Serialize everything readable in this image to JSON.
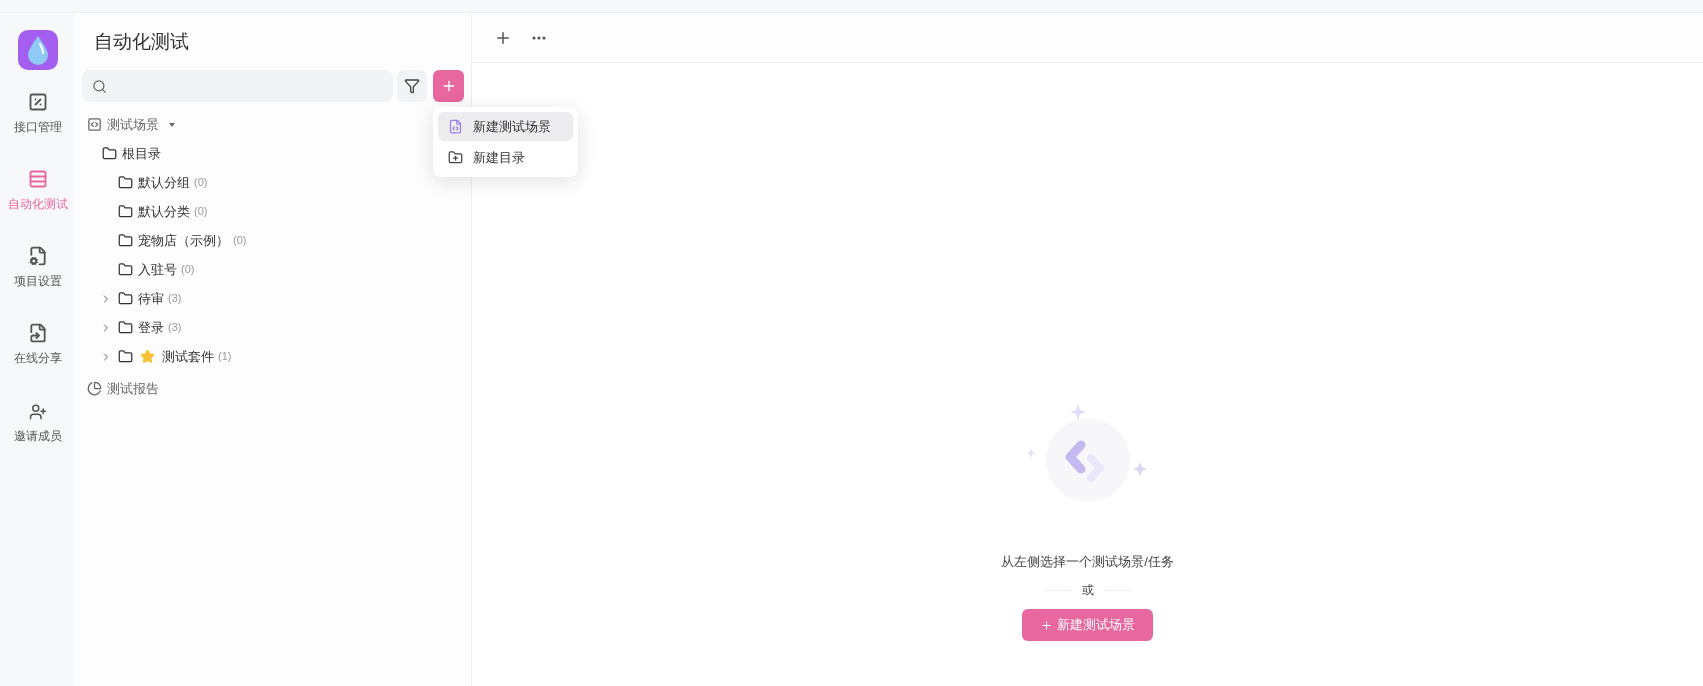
{
  "nav": {
    "items": [
      {
        "label": "接口管理",
        "selected": false
      },
      {
        "label": "自动化测试",
        "selected": true
      },
      {
        "label": "项目设置",
        "selected": false
      },
      {
        "label": "在线分享",
        "selected": false
      }
    ],
    "invite": {
      "label": "邀请成员"
    }
  },
  "sidebar": {
    "title": "自动化测试",
    "scenes": {
      "label": "测试场景",
      "expanded": true,
      "children": [
        {
          "label": "根目录",
          "children": [
            {
              "label": "默认分组",
              "count": "(0)",
              "collapsible": false,
              "starred": false
            },
            {
              "label": "默认分类",
              "count": "(0)",
              "collapsible": false,
              "starred": false
            },
            {
              "label": "宠物店（示例）",
              "count": "(0)",
              "collapsible": false,
              "starred": false
            },
            {
              "label": "入驻号",
              "count": "(0)",
              "collapsible": false,
              "starred": false
            },
            {
              "label": "待审",
              "count": "(3)",
              "collapsible": true,
              "starred": false
            },
            {
              "label": "登录",
              "count": "(3)",
              "collapsible": true,
              "starred": false
            },
            {
              "label": "测试套件",
              "count": "(1)",
              "collapsible": true,
              "starred": true
            }
          ]
        }
      ]
    },
    "reports": {
      "label": "测试报告"
    }
  },
  "add_menu": {
    "items": [
      {
        "label": "新建测试场景",
        "selected": true
      },
      {
        "label": "新建目录",
        "selected": false
      }
    ]
  },
  "empty_state": {
    "message": "从左侧选择一个测试场景/任务",
    "or": "或",
    "button": "新建测试场景"
  }
}
